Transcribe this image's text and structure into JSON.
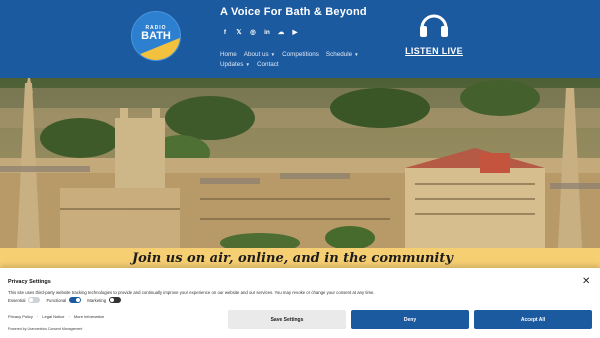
{
  "site": {
    "logo_top": "RADIO",
    "logo_main": "BATH",
    "tagline": "A Voice For Bath & Beyond",
    "listen_label": "LISTEN LIVE"
  },
  "socials": [
    "f",
    "𝕏",
    "◎",
    "in",
    "☁",
    "▶"
  ],
  "nav": {
    "home": "Home",
    "about": "About us",
    "competitions": "Competitions",
    "schedule": "Schedule",
    "updates": "Updates",
    "contact": "Contact"
  },
  "banner": {
    "text": "Join us on air, online, and in the community"
  },
  "consent": {
    "title": "Privacy Settings",
    "description": "This site uses third-party website tracking technologies to provide and continually improve your experience on our website and our services. You may revoke or change your consent at any time.",
    "toggle_essential": "Essential",
    "toggle_functional": "Functional",
    "toggle_marketing": "Marketing",
    "link_privacy": "Privacy Policy",
    "link_separator1": "·",
    "link_legal": "Legal Notice",
    "link_separator2": "·",
    "link_more": "More Information",
    "powered": "Powered by Usercentrics Consent Management",
    "btn_save": "Save Settings",
    "btn_deny": "Deny",
    "btn_accept": "Accept All",
    "close": "✕"
  },
  "colors": {
    "header_blue": "#1c5aa0",
    "banner_yellow": "#f7cf73",
    "logo_yellow": "#f2c13e"
  }
}
